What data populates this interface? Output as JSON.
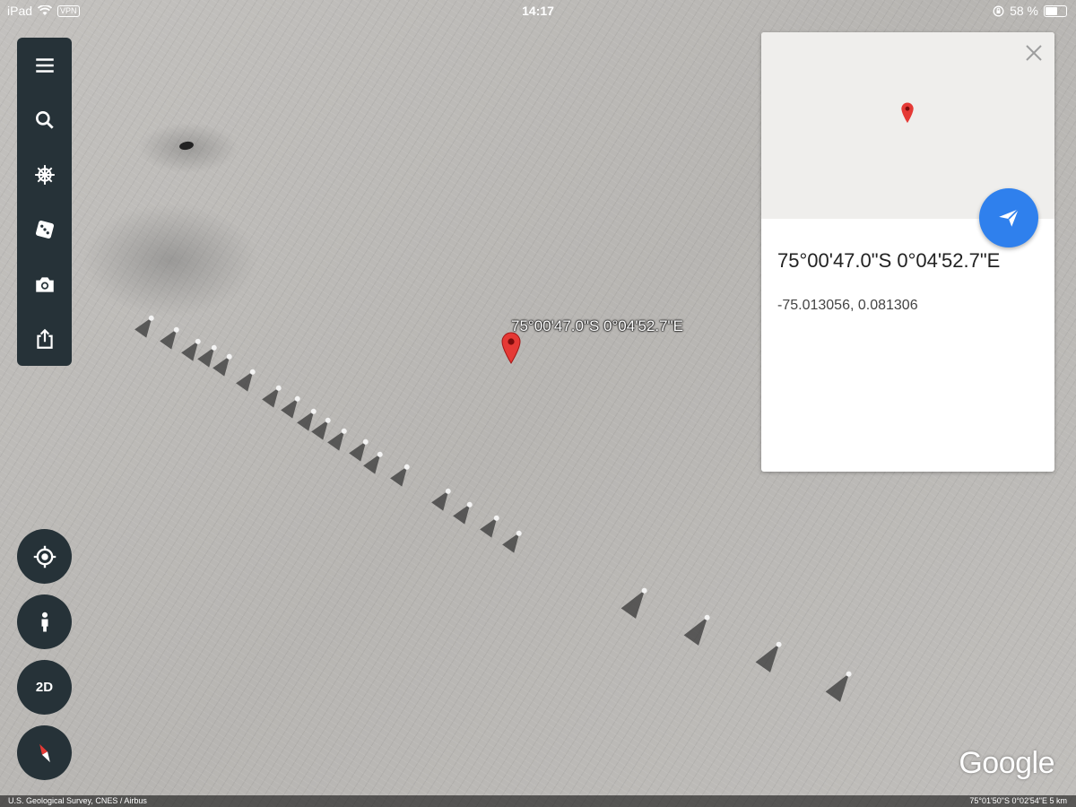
{
  "status_bar": {
    "device": "iPad",
    "vpn": "VPN",
    "time": "14:17",
    "battery": "58 %",
    "battery_level": 0.58
  },
  "toolbar": {
    "items": [
      "menu-icon",
      "search-icon",
      "voyager-wheel-icon",
      "dice-icon",
      "camera-icon",
      "share-icon"
    ]
  },
  "map_controls": {
    "view_mode": "2D"
  },
  "placemark": {
    "label": "75°00'47.0\"S 0°04'52.7\"E"
  },
  "info_card": {
    "title": "75°00'47.0\"S 0°04'52.7\"E",
    "decimal": "-75.013056, 0.081306"
  },
  "branding": {
    "logo": "Google"
  },
  "footer": {
    "attribution": "U.S. Geological Survey, CNES / Airbus",
    "coordinates": "75°01'50\"S 0°02'54\"E  5 km"
  },
  "colors": {
    "toolbar_bg": "#263238",
    "accent_blue": "#2f80ed",
    "pin_red": "#e53935"
  }
}
